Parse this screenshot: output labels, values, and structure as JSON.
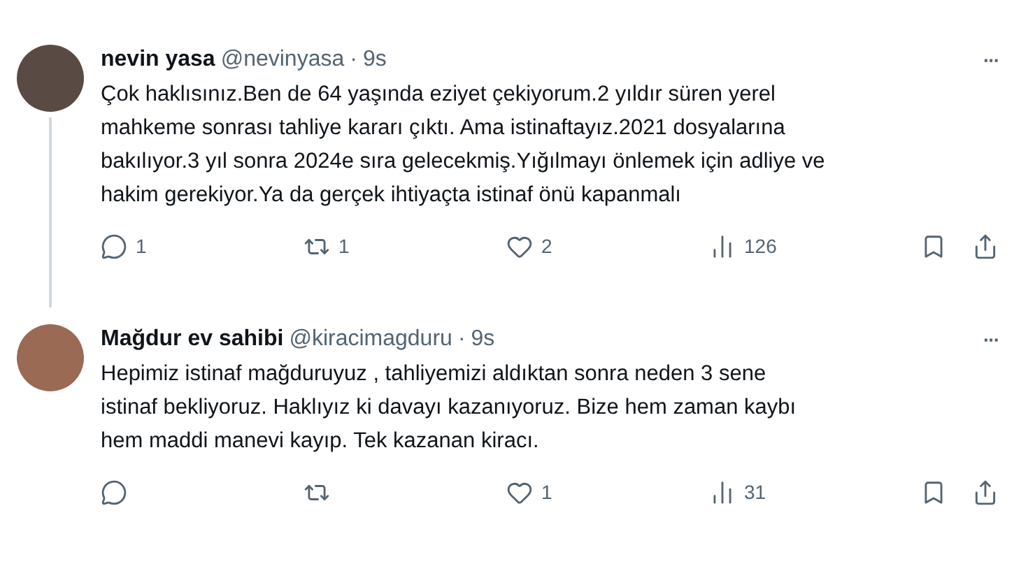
{
  "tweets": [
    {
      "name": "nevin yasa",
      "handle": "@nevinyasa",
      "time": "9s",
      "separator": "·",
      "more": "···",
      "thread_line": true,
      "text": "Çok haklısınız.Ben de 64 yaşında eziyet çekiyorum.2 yıldır süren yerel mahkeme sonrası tahliye kararı çıktı. Ama istinaftayız.2021 dosyalarına bakılıyor.3 yıl sonra 2024e sıra gelecekmiş.Yığılmayı önlemek için adliye ve hakim gerekiyor.Ya da gerçek ihtiyaçta istinaf önü kapanmalı",
      "actions": [
        {
          "kind": "reply",
          "count": "1"
        },
        {
          "kind": "retweet",
          "count": "1"
        },
        {
          "kind": "like",
          "count": "2"
        },
        {
          "kind": "views",
          "count": "126"
        }
      ]
    },
    {
      "name": "Mağdur ev sahibi",
      "handle": "@kiracimagduru",
      "time": "9s",
      "separator": "·",
      "more": "···",
      "thread_line": false,
      "text": "Hepimiz istinaf mağduruyuz , tahliyemizi aldıktan sonra neden 3 sene istinaf bekliyoruz. Haklıyız ki davayı kazanıyoruz. Bize hem zaman kaybı hem maddi manevi kayıp. Tek kazanan kiracı.",
      "actions": [
        {
          "kind": "reply"
        },
        {
          "kind": "retweet"
        },
        {
          "kind": "like",
          "count": "1"
        },
        {
          "kind": "views",
          "count": "31"
        }
      ]
    }
  ]
}
